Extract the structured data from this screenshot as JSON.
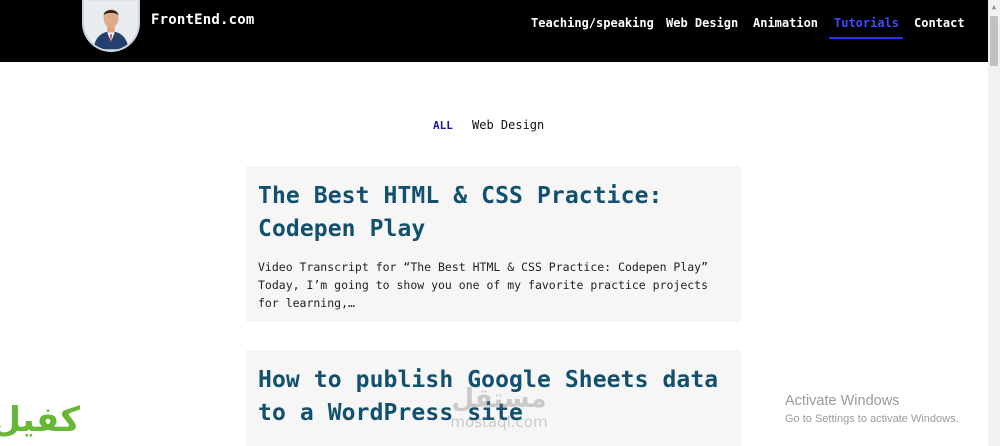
{
  "header": {
    "brand": "FrontEnd.com",
    "nav": [
      {
        "label": "Teaching/speaking",
        "active": false
      },
      {
        "label": "Web Design",
        "active": false
      },
      {
        "label": "Animation",
        "active": false
      },
      {
        "label": "Tutorials",
        "active": true
      },
      {
        "label": "Contact",
        "active": false
      }
    ]
  },
  "filters": [
    {
      "label": "ALL",
      "active": true
    },
    {
      "label": "Web Design",
      "active": false
    }
  ],
  "posts": [
    {
      "title": "The Best HTML & CSS Practice: Codepen Play",
      "excerpt": "Video Transcript for “The Best HTML & CSS Practice: Codepen Play” Today, I’m going to show you one of my favorite practice projects for learning,…"
    },
    {
      "title": "How to publish Google Sheets data to a WordPress site",
      "excerpt": ""
    }
  ],
  "os_overlay": {
    "title": "Activate Windows",
    "subtitle": "Go to Settings to activate Windows."
  },
  "watermarks": {
    "center_arabic": "مستقل",
    "center_latin": "mostaql.com",
    "left_arabic": "كفيل"
  },
  "colors": {
    "nav_bg": "#000000",
    "nav_active": "#3b4cff",
    "title": "#12506e",
    "card_bg": "#f6f6f6"
  }
}
